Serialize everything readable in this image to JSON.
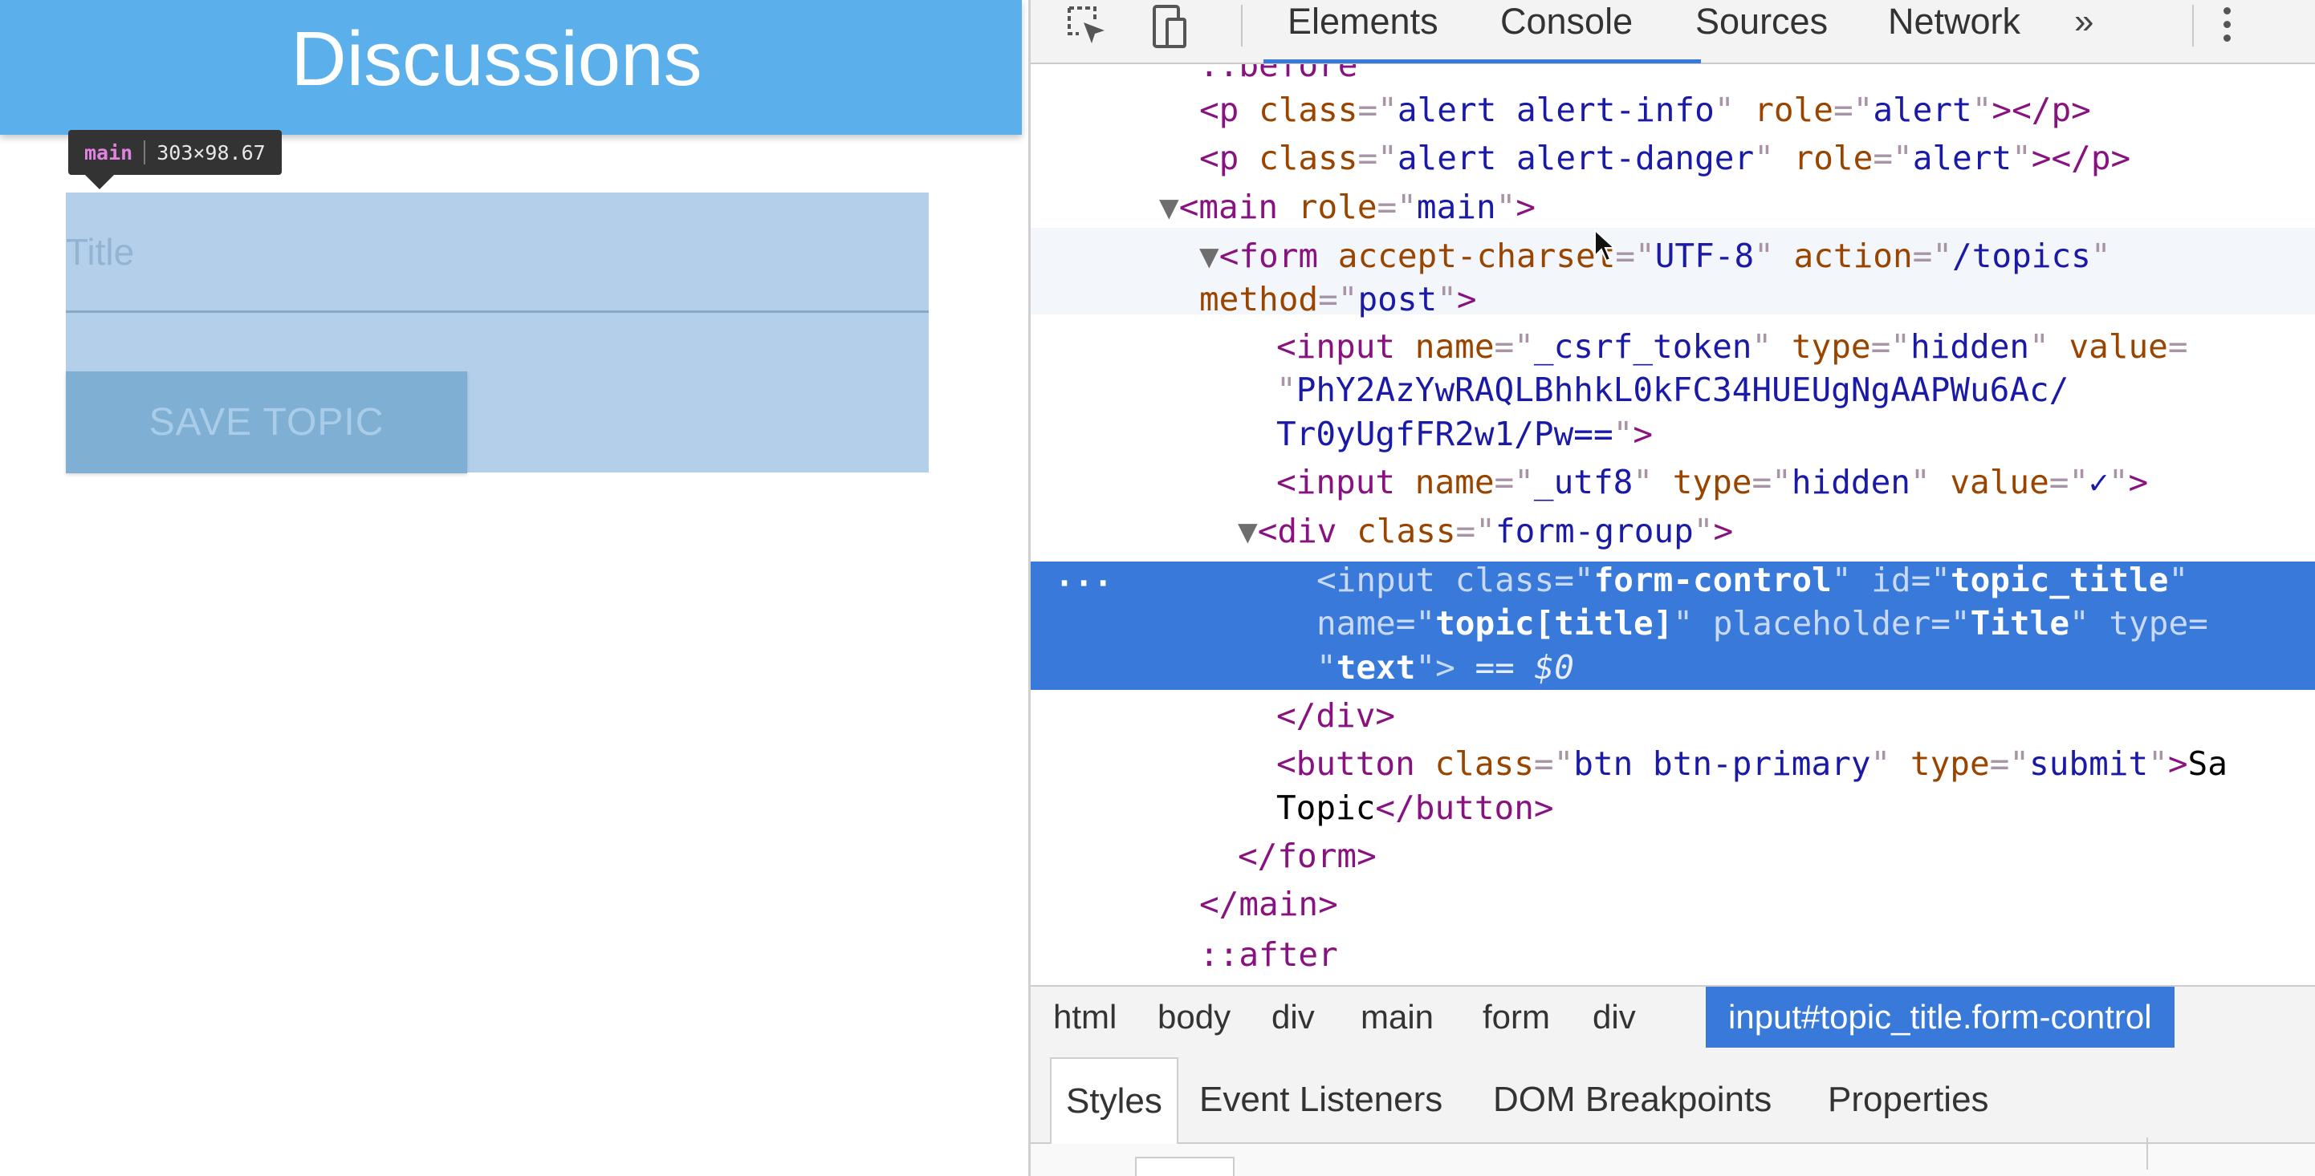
{
  "page": {
    "header_title": "Discussions",
    "title_placeholder": "Title",
    "save_button_label": "SAVE TOPIC"
  },
  "inspector_tooltip": {
    "tag": "main",
    "size": "303×98.67"
  },
  "devtools": {
    "tabs": [
      "Elements",
      "Console",
      "Sources",
      "Network"
    ],
    "more_tabs": "»",
    "active_tab": "Elements",
    "dom_lines": {
      "before": "::before",
      "p_info": {
        "class": "alert alert-info",
        "role": "alert"
      },
      "p_danger": {
        "class": "alert alert-danger",
        "role": "alert"
      },
      "main": {
        "role": "main"
      },
      "form": {
        "accept_charset": "UTF-8",
        "action": "/topics",
        "method": "post"
      },
      "csrf": {
        "name": "_csrf_token",
        "type": "hidden",
        "value_1": "PhY2AzYwRAQLBhhkL0kFC34HUEUgNgAAPWu6Ac/",
        "value_2": "Tr0yUgfFR2w1/Pw=="
      },
      "utf8": {
        "name": "_utf8",
        "type": "hidden",
        "value": "✓"
      },
      "div": {
        "class": "form-group"
      },
      "selected_input": {
        "class": "form-control",
        "id": "topic_title",
        "name": "topic[title]",
        "placeholder": "Title",
        "type": "text",
        "marker": "== $0"
      },
      "button": {
        "class": "btn btn-primary",
        "type": "submit",
        "text_1": "Sa",
        "text_2": "Topic"
      },
      "after": "::after"
    },
    "breadcrumbs": [
      "html",
      "body",
      "div",
      "main",
      "form",
      "div",
      "input#topic_title.form-control"
    ],
    "panel_tabs": [
      "Styles",
      "Event Listeners",
      "DOM Breakpoints",
      "Properties"
    ],
    "colors": {
      "accent": "#3879d9",
      "header_blue": "#5bb0ec",
      "highlight": "#b4cfea"
    }
  }
}
